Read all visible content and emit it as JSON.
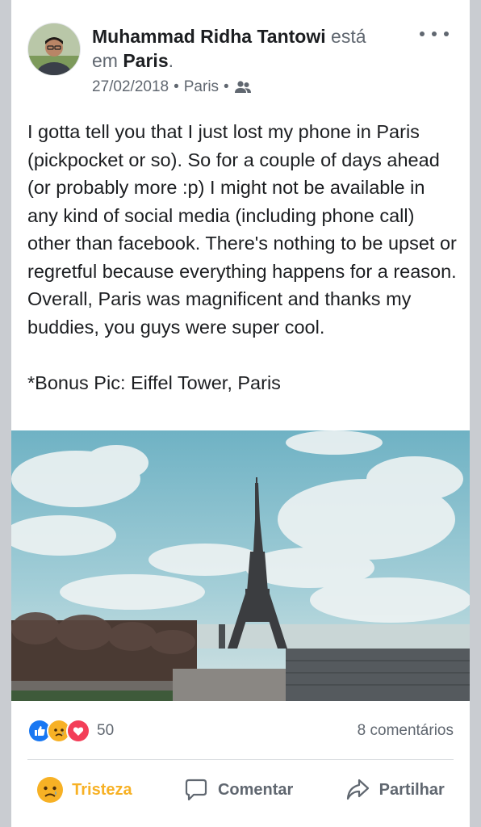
{
  "post": {
    "author": "Muhammad Ridha Tantowi",
    "status_pre": "está",
    "status_mid": "em",
    "location": "Paris",
    "status_end": ".",
    "date": "27/02/2018",
    "meta_location": "Paris",
    "audience_icon": "friends-icon",
    "text": "I gotta tell you that I just lost my phone in Paris (pickpocket or so). So for a couple of days ahead (or probably more :p) I might not be available in any kind of social media (including phone call) other than facebook. There's nothing to be upset or regretful because everything happens for a reason. Overall, Paris was magnificent and thanks my buddies, you guys were super cool.\n\n*Bonus Pic: Eiffel Tower, Paris",
    "photo_icon": "eiffel-tower-photo"
  },
  "stats": {
    "reactions": [
      "like",
      "sad",
      "love"
    ],
    "reaction_count": "50",
    "comments": "8 comentários"
  },
  "actions": {
    "react_label": "Tristeza",
    "comment_label": "Comentar",
    "share_label": "Partilhar"
  },
  "colors": {
    "like": "#1877f2",
    "love": "#f33e58",
    "sad": "#f7b125",
    "text": "#1c1e21",
    "muted": "#606770"
  }
}
